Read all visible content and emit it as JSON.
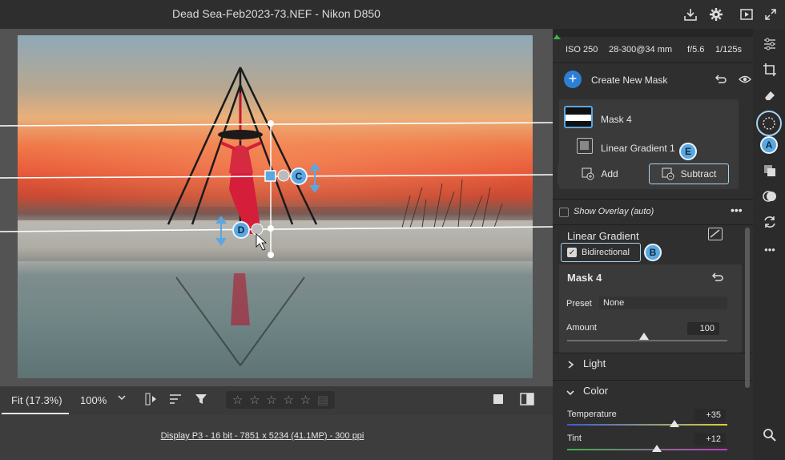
{
  "window": {
    "title": "Dead Sea-Feb2023-73.NEF  -  Nikon D850"
  },
  "titlebar_icons": [
    "export-icon",
    "gear-icon",
    "slideshow-icon",
    "fullscreen-icon"
  ],
  "exif": {
    "iso": "ISO 250",
    "lens": "28-300@34 mm",
    "aperture": "f/5.6",
    "shutter": "1/125s"
  },
  "masks": {
    "create_label": "Create New Mask",
    "items": [
      {
        "label": "Mask 4"
      },
      {
        "label": "Linear Gradient 1"
      }
    ],
    "add_label": "Add",
    "subtract_label": "Subtract",
    "show_overlay_label": "Show Overlay (auto)"
  },
  "linear_gradient": {
    "title": "Linear Gradient",
    "bidirectional_label": "Bidirectional",
    "bidirectional_checked": true
  },
  "mask_panel": {
    "title": "Mask 4",
    "preset_label": "Preset",
    "preset_value": "None",
    "amount_label": "Amount",
    "amount_value": "100",
    "amount_fraction": 1.0
  },
  "sections": {
    "light": "Light",
    "color": "Color"
  },
  "color": {
    "temperature_label": "Temperature",
    "temperature_value": "+35",
    "tint_label": "Tint",
    "tint_value": "+12"
  },
  "callouts": {
    "a": "A",
    "b": "B",
    "c": "C",
    "d": "D",
    "e": "E"
  },
  "bottombar": {
    "fit_label": "Fit (17.3%)",
    "zoom_label": "100%",
    "stars": [
      "☆",
      "☆",
      "☆",
      "☆",
      "☆"
    ]
  },
  "footer": {
    "info": "Display P3 - 16 bit - 7851 x 5234 (41.1MP) - 300 ppi"
  },
  "colors": {
    "accent": "#5ba7e0",
    "highlight": "#a8d2f0",
    "panel": "#2f2f2f"
  }
}
